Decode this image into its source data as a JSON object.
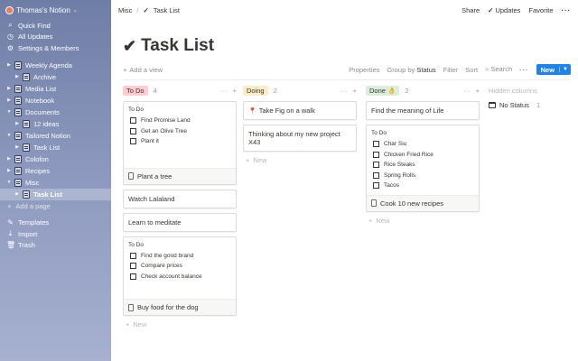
{
  "sidebar": {
    "workspace": "Thomas's Notion",
    "quick_find": "Quick Find",
    "all_updates": "All Updates",
    "settings": "Settings & Members",
    "tree": [
      {
        "label": "Weekly Agenda",
        "level": 0
      },
      {
        "label": "Archive",
        "level": 1
      },
      {
        "label": "Media List",
        "level": 0
      },
      {
        "label": "Notebook",
        "level": 0
      },
      {
        "label": "Documents",
        "level": 0
      },
      {
        "label": "12 ideas",
        "level": 1
      },
      {
        "label": "Tailored Notion",
        "level": 0
      },
      {
        "label": "Task List",
        "level": 1
      },
      {
        "label": "Colofon",
        "level": 0
      },
      {
        "label": "Recipes",
        "level": 0
      },
      {
        "label": "Misc",
        "level": 0
      },
      {
        "label": "Task List",
        "level": 1
      }
    ],
    "add_page": "Add a page",
    "templates": "Templates",
    "import": "Import",
    "trash": "Trash"
  },
  "topbar": {
    "crumb1": "Misc",
    "crumb2": "Task List",
    "share": "Share",
    "updates": "Updates",
    "favorite": "Favorite"
  },
  "page": {
    "title": "Task List",
    "add_view": "Add a view",
    "properties": "Properties",
    "group_by": "Group by",
    "group_by_value": "Status",
    "filter": "Filter",
    "sort": "Sort",
    "search": "Search",
    "new": "New"
  },
  "board": {
    "todo": {
      "label": "To Do",
      "count": "4",
      "color": "#ffccd1",
      "card1": {
        "sub": "To Do",
        "items": [
          "Find Promise Land",
          "Get an Olive Tree",
          "Plant it"
        ],
        "foot": "Plant a tree"
      },
      "card2": "Watch Lalaland",
      "card3": "Learn to meditate",
      "card4": {
        "sub": "To Do",
        "items": [
          "Find the good brand",
          "Compare prices",
          "Check account balance"
        ],
        "foot": "Buy food for the dog"
      },
      "new": "New"
    },
    "doing": {
      "label": "Doing",
      "count": "2",
      "color": "#fdecc8",
      "card1": "Take Fig on a walk",
      "card2": "Thinking about my new project X43",
      "new": "New"
    },
    "done": {
      "label": "Done",
      "emoji": "👌",
      "count": "2",
      "color": "#dbeddb",
      "card1": "Find the meaning of Life",
      "card2": {
        "sub": "To Do",
        "items": [
          "Char Siu",
          "Chicken Fried Rice",
          "Rice Steaks",
          "Spring Rolls",
          "Tacos"
        ],
        "foot": "Cook 10 new recipes"
      },
      "new": "New"
    },
    "hidden": {
      "label": "Hidden columns",
      "no_status": "No Status",
      "count": "1"
    }
  }
}
